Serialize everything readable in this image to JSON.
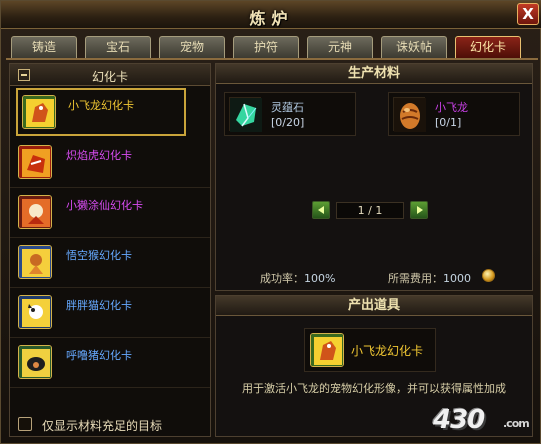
{
  "window": {
    "title": "炼炉",
    "close_label": "X"
  },
  "tabs": [
    {
      "label": "铸造",
      "active": false
    },
    {
      "label": "宝石",
      "active": false
    },
    {
      "label": "宠物",
      "active": false
    },
    {
      "label": "护符",
      "active": false
    },
    {
      "label": "元神",
      "active": false
    },
    {
      "label": "诛妖帖",
      "active": false
    },
    {
      "label": "幻化卡",
      "active": true
    }
  ],
  "left_panel": {
    "header": "幻化卡",
    "items": [
      {
        "label": "小飞龙幻化卡",
        "color": "#f1c833",
        "selected": true
      },
      {
        "label": "炽焰虎幻化卡",
        "color": "#d84cf2",
        "selected": false
      },
      {
        "label": "小獭涂仙幻化卡",
        "color": "#d84cf2",
        "selected": false
      },
      {
        "label": "悟空猴幻化卡",
        "color": "#66a9ff",
        "selected": false
      },
      {
        "label": "胖胖猫幻化卡",
        "color": "#66a9ff",
        "selected": false
      },
      {
        "label": "呼噜猪幻化卡",
        "color": "#66a9ff",
        "selected": false
      }
    ],
    "filter_checkbox_label": "仅显示材料充足的目标",
    "filter_checked": false
  },
  "materials": {
    "title": "生产材料",
    "items": [
      {
        "name": "灵蕴石",
        "count": "[0/20]",
        "icon": "blue-crystal-icon"
      },
      {
        "name": "小飞龙",
        "count": "[0/1]",
        "icon": "dragon-egg-icon"
      }
    ],
    "pager": {
      "text": "1 / 1"
    },
    "success_rate_label": "成功率：",
    "success_rate_value": "100%",
    "fee_label": "所需费用：",
    "fee_value": "1000"
  },
  "output": {
    "title": "产出道具",
    "item_name": "小飞龙幻化卡",
    "description": "用于激活小飞龙的宠物幻化形像，并可以获得属性加成"
  },
  "watermark": {
    "text": "430",
    "suffix": ".com"
  },
  "colors": {
    "accent_gold": "#f1c833",
    "tab_active": "#8a2418",
    "pager_green": "#5c9e33"
  }
}
